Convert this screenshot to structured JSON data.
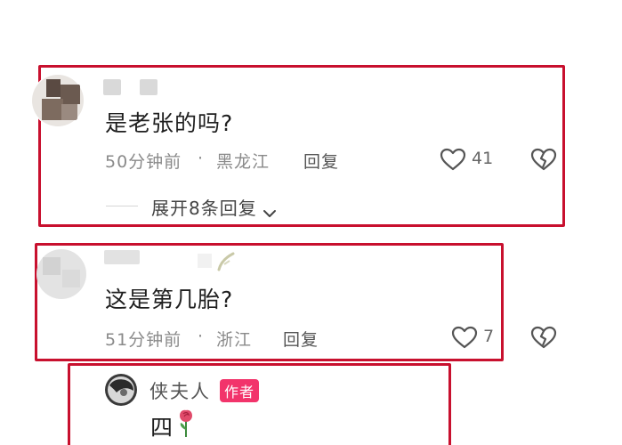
{
  "comments": [
    {
      "text": "是老张的吗?",
      "time": "50分钟前",
      "separator": "·",
      "location": "黑龙江",
      "reply_label": "回复",
      "likes": "41",
      "expand_label": "展开8条回复"
    },
    {
      "text": "这是第几胎?",
      "time": "51分钟前",
      "separator": "·",
      "location": "浙江",
      "reply_label": "回复",
      "likes": "7"
    }
  ],
  "author_reply": {
    "name": "侠夫人",
    "badge": "作者",
    "text": "四"
  },
  "colors": {
    "highlight": "#c8102e",
    "author_badge": "#f2346b",
    "rose": "#e04a6a"
  },
  "icons": [
    "heart-outline-icon",
    "broken-heart-icon",
    "chevron-down-icon",
    "rose-icon"
  ]
}
